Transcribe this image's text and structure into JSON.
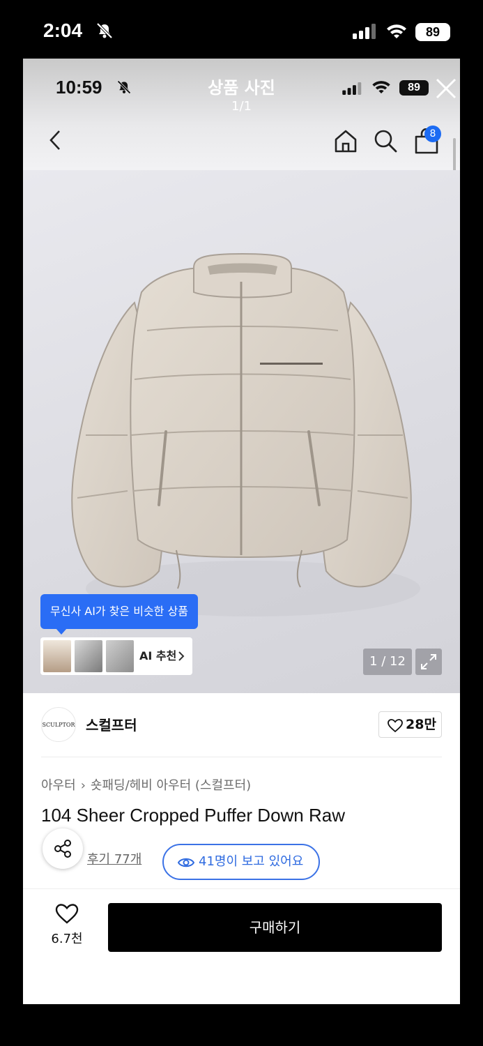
{
  "outer_status": {
    "time": "2:04",
    "battery": "89"
  },
  "viewer": {
    "title": "상품 사진",
    "counter": "1/1"
  },
  "inner_status": {
    "time": "10:59",
    "battery": "89"
  },
  "nav": {
    "cart_count": "8"
  },
  "image": {
    "counter": "1 / 12"
  },
  "ai": {
    "bubble": "무신사 AI가 찾은 비슷한 상품",
    "recommend_label": "AI 추천"
  },
  "brand": {
    "logo_text": "SCULPTOR",
    "name": "스컬프터",
    "likes": "28만"
  },
  "breadcrumb": {
    "items": [
      "아우터",
      "숏패딩/헤비 아우터 (스컬프터)"
    ]
  },
  "product": {
    "name": "104 Sheer Cropped Puffer Down Raw",
    "reviews": "후기 77개",
    "viewers": "41명이 보고 있어요"
  },
  "bottom_bar": {
    "wish_count": "6.7천",
    "buy_label": "구매하기"
  },
  "colors": {
    "accent": "#2a6df5",
    "buy_button": "#000000",
    "jacket": "#ddd5cb"
  },
  "icons": [
    "bell-slash-icon",
    "signal-icon",
    "wifi-icon",
    "close-icon",
    "back-icon",
    "home-icon",
    "search-icon",
    "cart-icon",
    "expand-icon",
    "heart-icon",
    "share-icon",
    "eye-icon",
    "chevron-right-icon"
  ]
}
